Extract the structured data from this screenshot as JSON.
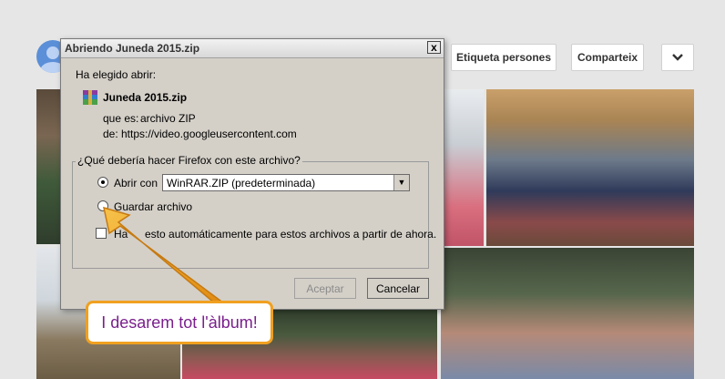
{
  "header": {
    "buttons": {
      "tag_people": "Etiqueta persones",
      "share": "Comparteix"
    },
    "more_icon": "chevron-down-icon"
  },
  "dialog": {
    "title": "Abriendo Juneda 2015.zip",
    "close_label": "x",
    "chosen_label": "Ha elegido abrir:",
    "file_name": "Juneda 2015.zip",
    "type_label": "que es:",
    "type_value": "archivo ZIP",
    "from_label": "de:",
    "from_value": "https://video.googleusercontent.com",
    "question": "¿Qué debería hacer Firefox con este archivo?",
    "open_with_label": "Abrir con",
    "open_with_value": "WinRAR.ZIP (predeterminada)",
    "save_label": "Guardar archivo",
    "auto_label_prefix": "Ha",
    "auto_label_rest": "esto automáticamente para estos archivos a partir de ahora.",
    "accept_label": "Aceptar",
    "cancel_label": "Cancelar",
    "open_with_selected": true,
    "auto_checked": false
  },
  "callout": {
    "text": "I desarem tot l'àlbum!",
    "color": "#7a1f8c",
    "border_color": "#f0a020"
  }
}
